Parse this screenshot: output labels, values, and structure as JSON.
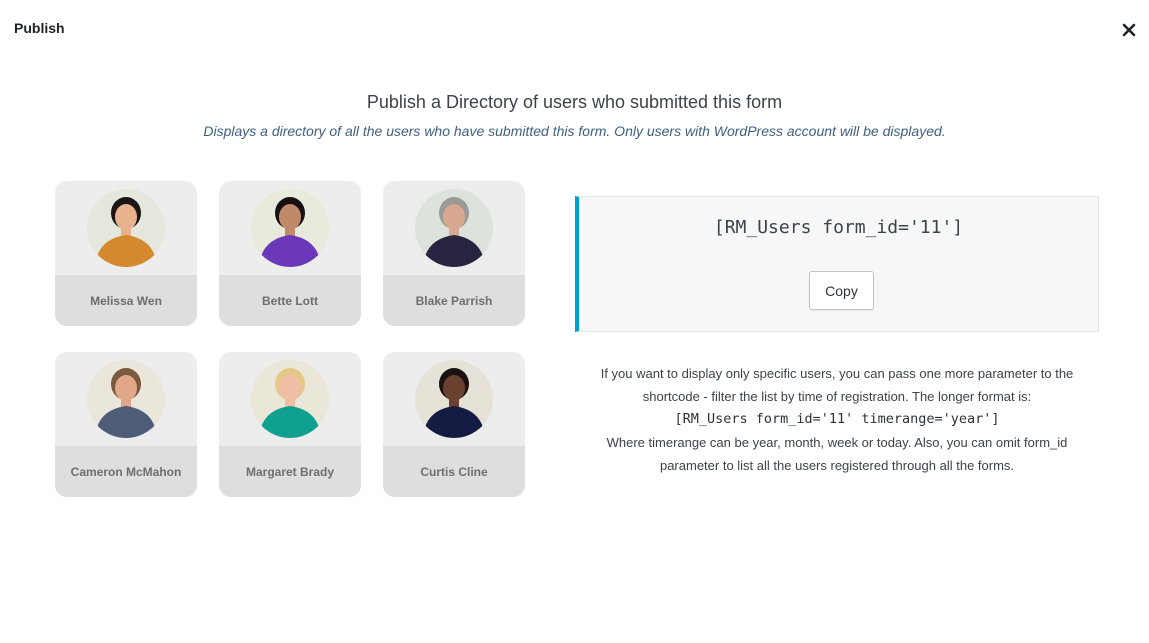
{
  "modal": {
    "title": "Publish",
    "close_icon": "close-icon"
  },
  "header": {
    "title": "Publish a Directory of users who submitted this form",
    "subtitle": "Displays a directory of all the users who have submitted this form. Only users with WordPress account will be displayed."
  },
  "users": [
    {
      "name": "Melissa Wen",
      "shirt": "#d4892e",
      "skin": "#e8b28f",
      "hair": "#1b1414",
      "bg": "#e4e8dc"
    },
    {
      "name": "Bette Lott",
      "shirt": "#6a38b8",
      "skin": "#c08a6a",
      "hair": "#161010",
      "bg": "#e8ebdc"
    },
    {
      "name": "Blake Parrish",
      "shirt": "#272440",
      "skin": "#d8a890",
      "hair": "#9a9a98",
      "bg": "#dde3dc"
    },
    {
      "name": "Cameron McMahon",
      "shirt": "#4e5c78",
      "skin": "#e0a888",
      "hair": "#7a5a3e",
      "bg": "#ebe6dc"
    },
    {
      "name": "Margaret Brady",
      "shirt": "#10a090",
      "skin": "#eebfa5",
      "hair": "#e4c888",
      "bg": "#eae6d8"
    },
    {
      "name": "Curtis Cline",
      "shirt": "#141c44",
      "skin": "#6a4030",
      "hair": "#1a1210",
      "bg": "#e6e2d8"
    }
  ],
  "shortcode": {
    "value": "[RM_Users form_id='11']",
    "copy_label": "Copy",
    "accent": "#00a0d2"
  },
  "help": {
    "line1": "If you want to display only specific users, you can pass one more parameter to the shortcode - filter the list by time of registration. The longer format is:",
    "code": "[RM_Users form_id='11' timerange='year']",
    "line2": "Where timerange can be year, month, week or today. Also, you can omit form_id parameter to list all the users registered through all the forms."
  }
}
